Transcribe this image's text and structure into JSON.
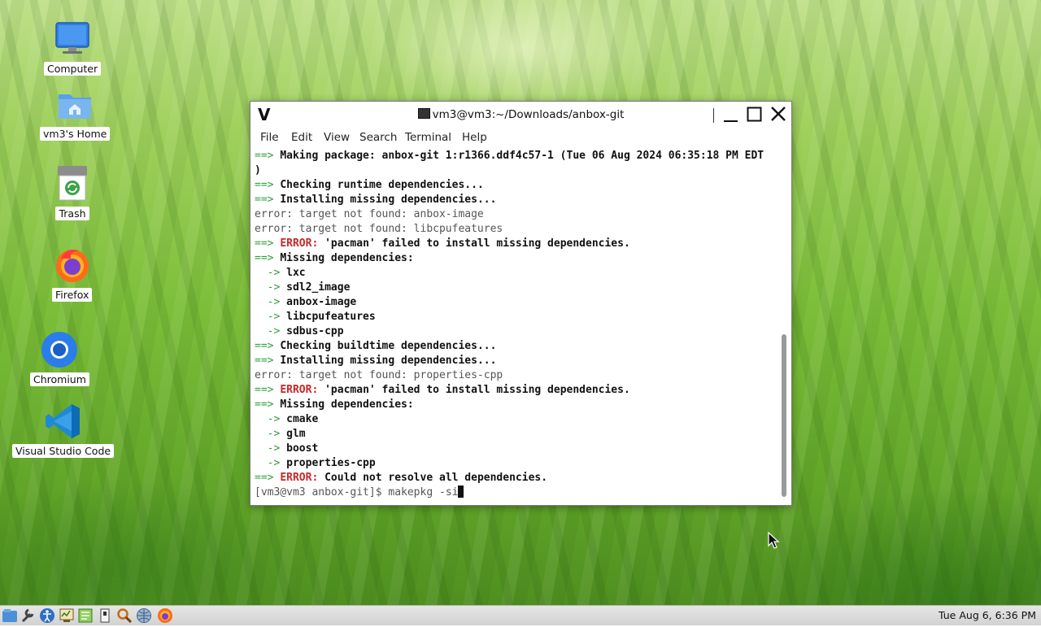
{
  "desktop": {
    "icons": [
      {
        "label": "Computer",
        "icon": "monitor-icon"
      },
      {
        "label": "vm3's Home",
        "icon": "home-folder-icon"
      },
      {
        "label": "Trash",
        "icon": "trash-icon"
      },
      {
        "label": "Firefox",
        "icon": "firefox-icon"
      },
      {
        "label": "Chromium",
        "icon": "chromium-icon"
      },
      {
        "label": "Visual Studio Code",
        "icon": "vscode-icon"
      }
    ]
  },
  "window": {
    "title": "vm3@vm3:~/Downloads/anbox-git",
    "wm_logo": "V",
    "menu": [
      "File",
      "Edit",
      "View",
      "Search",
      "Terminal",
      "Help"
    ]
  },
  "terminal": {
    "lines": [
      {
        "prefix": "==>",
        "style": "bold",
        "text": "Making package: anbox-git 1:r1366.ddf4c57-1 (Tue 06 Aug 2024 06:35:18 PM EDT"
      },
      {
        "prefix": "",
        "style": "bold",
        "text": ")"
      },
      {
        "prefix": "==>",
        "style": "bold",
        "text": "Checking runtime dependencies..."
      },
      {
        "prefix": "==>",
        "style": "bold",
        "text": "Installing missing dependencies..."
      },
      {
        "prefix": "",
        "style": "plain",
        "text": "error: target not found: anbox-image"
      },
      {
        "prefix": "",
        "style": "plain",
        "text": "error: target not found: libcpufeatures"
      },
      {
        "prefix": "==>",
        "style": "error",
        "err_label": "ERROR:",
        "text": "'pacman' failed to install missing dependencies."
      },
      {
        "prefix": "==>",
        "style": "bold",
        "text": "Missing dependencies:"
      },
      {
        "prefix": "  ->",
        "style": "bold",
        "text": "lxc"
      },
      {
        "prefix": "  ->",
        "style": "bold",
        "text": "sdl2_image"
      },
      {
        "prefix": "  ->",
        "style": "bold",
        "text": "anbox-image"
      },
      {
        "prefix": "  ->",
        "style": "bold",
        "text": "libcpufeatures"
      },
      {
        "prefix": "  ->",
        "style": "bold",
        "text": "sdbus-cpp"
      },
      {
        "prefix": "==>",
        "style": "bold",
        "text": "Checking buildtime dependencies..."
      },
      {
        "prefix": "==>",
        "style": "bold",
        "text": "Installing missing dependencies..."
      },
      {
        "prefix": "",
        "style": "plain",
        "text": "error: target not found: properties-cpp"
      },
      {
        "prefix": "==>",
        "style": "error",
        "err_label": "ERROR:",
        "text": "'pacman' failed to install missing dependencies."
      },
      {
        "prefix": "==>",
        "style": "bold",
        "text": "Missing dependencies:"
      },
      {
        "prefix": "  ->",
        "style": "bold",
        "text": "cmake"
      },
      {
        "prefix": "  ->",
        "style": "bold",
        "text": "glm"
      },
      {
        "prefix": "  ->",
        "style": "bold",
        "text": "boost"
      },
      {
        "prefix": "  ->",
        "style": "bold",
        "text": "properties-cpp"
      },
      {
        "prefix": "==>",
        "style": "error",
        "err_label": "ERROR:",
        "text": "Could not resolve all dependencies."
      }
    ],
    "prompt": "[vm3@vm3 anbox-git]$ ",
    "command": "makepkg -si"
  },
  "taskbar": {
    "launchers": [
      "app-menu-icon",
      "settings-tools-icon",
      "accessibility-icon",
      "system-monitor-icon",
      "text-editor-icon",
      "file-manager-icon",
      "search-icon",
      "network-icon",
      "firefox-icon"
    ],
    "clock": "Tue Aug  6, 6:36 PM"
  },
  "colors": {
    "arrow": "#2f9e3b",
    "error": "#c62828",
    "grass": "#7dbf3a"
  }
}
